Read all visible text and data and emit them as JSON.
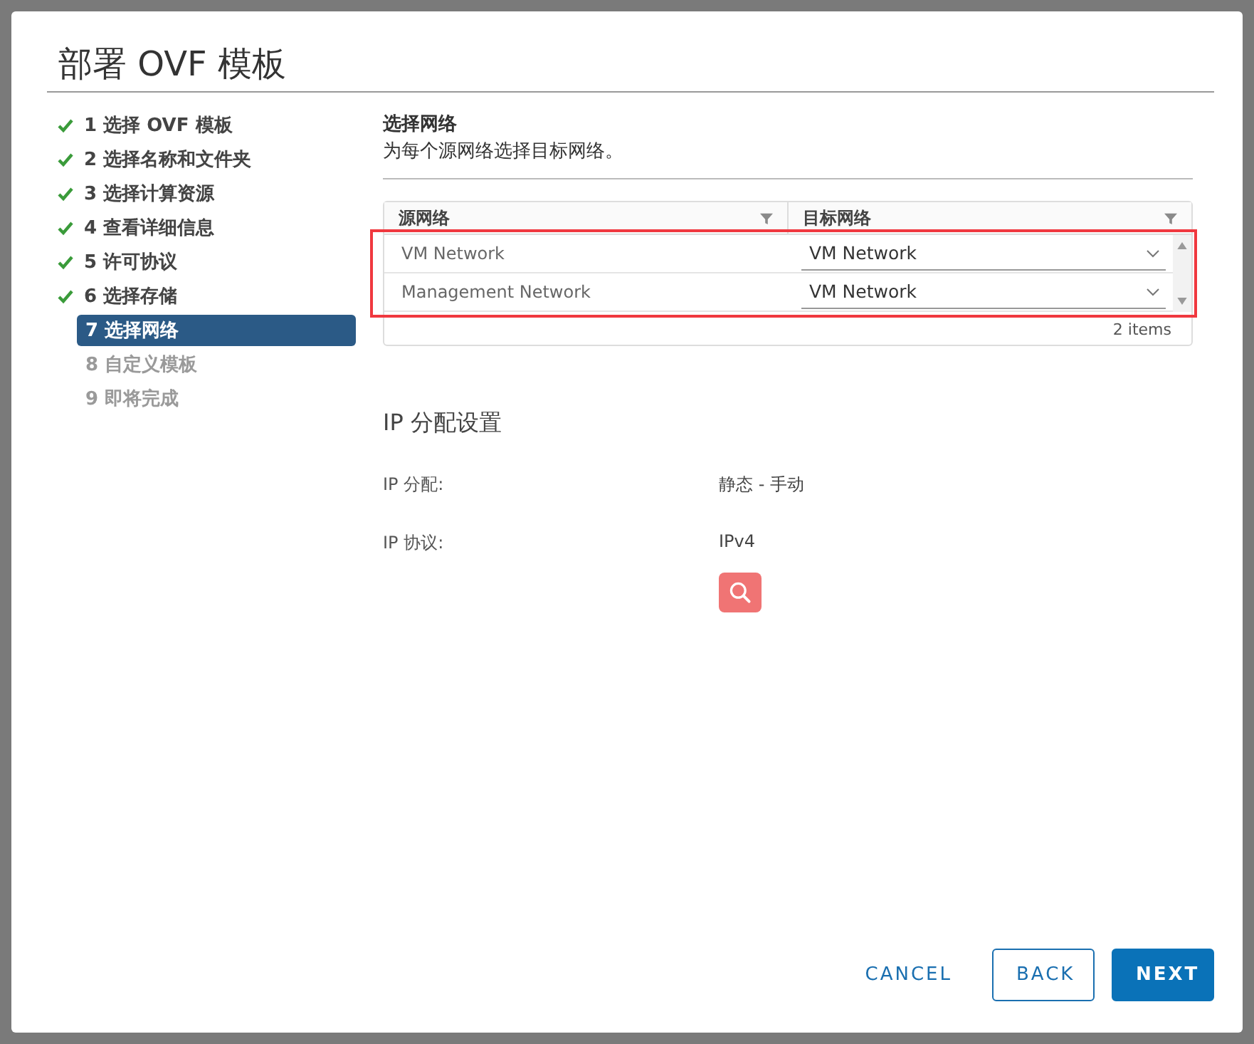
{
  "dialog": {
    "title": "部署 OVF 模板"
  },
  "steps": [
    {
      "label": "1 选择 OVF 模板",
      "done": true,
      "selected": false
    },
    {
      "label": "2 选择名称和文件夹",
      "done": true,
      "selected": false
    },
    {
      "label": "3 选择计算资源",
      "done": true,
      "selected": false
    },
    {
      "label": "4 查看详细信息",
      "done": true,
      "selected": false
    },
    {
      "label": "5 许可协议",
      "done": true,
      "selected": false
    },
    {
      "label": "6 选择存储",
      "done": true,
      "selected": false
    },
    {
      "label": "7 选择网络",
      "done": false,
      "selected": true
    },
    {
      "label": "8 自定义模板",
      "done": false,
      "selected": false
    },
    {
      "label": "9 即将完成",
      "done": false,
      "selected": false
    }
  ],
  "section": {
    "title": "选择网络",
    "description": "为每个源网络选择目标网络。"
  },
  "table": {
    "columns": [
      "源网络",
      "目标网络"
    ],
    "rows": [
      {
        "source": "VM Network",
        "destination": "VM Network"
      },
      {
        "source": "Management Network",
        "destination": "VM Network"
      }
    ],
    "footer": "2 items"
  },
  "ip_settings": {
    "title": "IP 分配设置",
    "fields": [
      {
        "label": "IP 分配:",
        "value": "静态 - 手动"
      },
      {
        "label": "IP 协议:",
        "value": "IPv4"
      }
    ]
  },
  "buttons": [
    {
      "label": "CANCEL",
      "kind": "flat"
    },
    {
      "label": "BACK",
      "kind": "outline"
    },
    {
      "label": "NEXT",
      "kind": "primary"
    }
  ]
}
